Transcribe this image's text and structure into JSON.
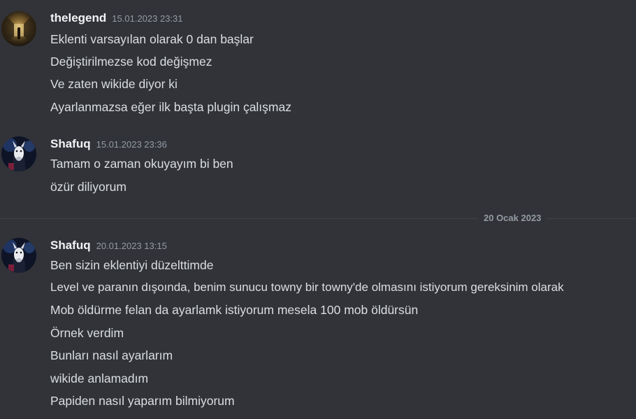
{
  "messages": [
    {
      "author": "thelegend",
      "timestamp": "15.01.2023 23:31",
      "avatar_icon": "tunnel-photo-avatar",
      "lines": [
        "Eklenti varsayılan olarak 0 dan başlar",
        "Değiştirilmezse kod değişmez",
        "Ve zaten wikide diyor ki",
        "Ayarlanmazsa eğer ilk başta plugin çalışmaz"
      ]
    },
    {
      "author": "Shafuq",
      "timestamp": "15.01.2023 23:36",
      "avatar_icon": "hooded-goat-avatar",
      "lines": [
        "Tamam o zaman okuyayım bi ben",
        "özür diliyorum"
      ]
    },
    {
      "author": "Shafuq",
      "timestamp": "20.01.2023 13:15",
      "avatar_icon": "hooded-goat-avatar",
      "lines": [
        "Ben sizin eklentiyi düzelttimde",
        "Level ve  paranın dışoında, benim sunucu towny bir towny'de olmasını istiyorum gereksinim olarak",
        "Mob öldürme felan da ayarlamk istiyorum mesela 100 mob öldürsün",
        "Örnek verdim",
        "Bunları nasıl ayarlarım",
        "wikide anlamadım",
        "Papiden nasıl yaparım bilmiyorum"
      ]
    }
  ],
  "date_divider": "20 Ocak 2023",
  "colors": {
    "background": "#313338",
    "username": "#f2f3f5",
    "text": "#dbdee1",
    "muted": "#949ba4",
    "divider": "#3f4147"
  }
}
